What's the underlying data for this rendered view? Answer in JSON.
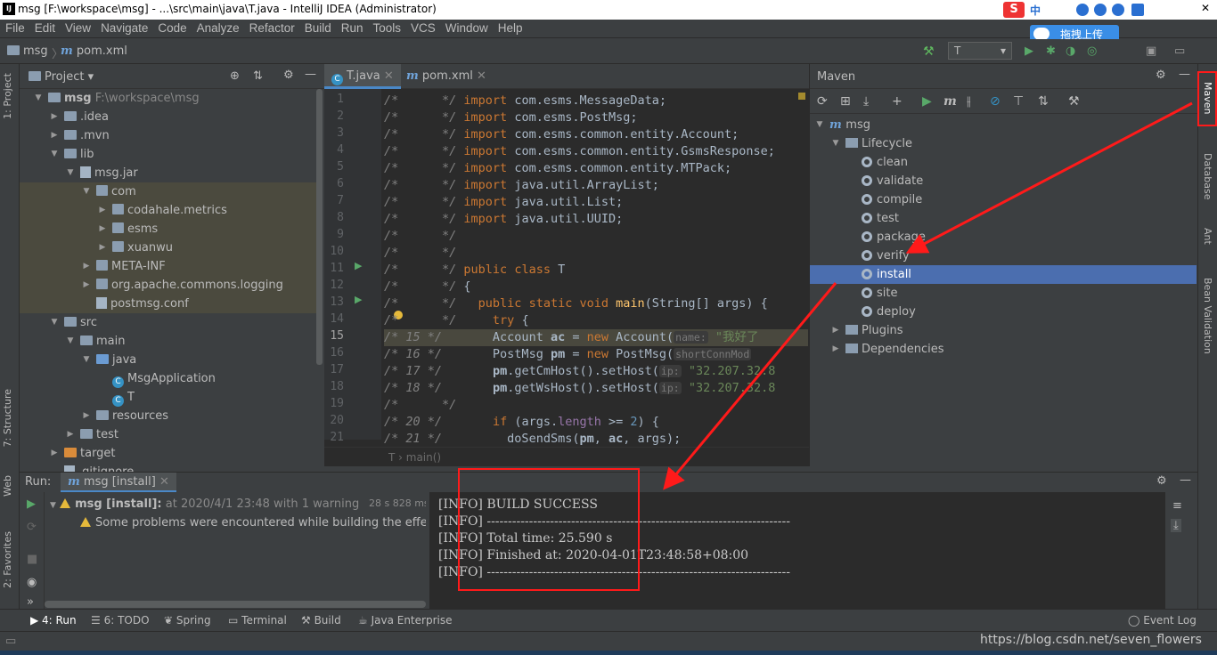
{
  "window": {
    "title": "msg [F:\\workspace\\msg] - ...\\src\\main\\java\\T.java - IntelliJ IDEA (Administrator)"
  },
  "ime": {
    "brand": "S",
    "lang": "中",
    "upload": "拖拽上传"
  },
  "menu": [
    "File",
    "Edit",
    "View",
    "Navigate",
    "Code",
    "Analyze",
    "Refactor",
    "Build",
    "Run",
    "Tools",
    "VCS",
    "Window",
    "Help"
  ],
  "nav": {
    "project": "msg",
    "file": "pom.xml",
    "run_config": "T"
  },
  "left_tabs": {
    "project": "1: Project",
    "structure": "7: Structure",
    "web": "Web",
    "favorites": "2: Favorites"
  },
  "right_tabs": {
    "maven": "Maven",
    "database": "Database",
    "ant": "Ant",
    "bean": "Bean Validation"
  },
  "project": {
    "header": "Project",
    "tree": [
      {
        "label": "msg",
        "extra": "F:\\workspace\\msg",
        "depth": 0,
        "arrow": "down",
        "icon": "folder"
      },
      {
        "label": ".idea",
        "depth": 1,
        "arrow": "right",
        "icon": "folder"
      },
      {
        "label": ".mvn",
        "depth": 1,
        "arrow": "right",
        "icon": "folder"
      },
      {
        "label": "lib",
        "depth": 1,
        "arrow": "down",
        "icon": "folder"
      },
      {
        "label": "msg.jar",
        "depth": 2,
        "arrow": "down",
        "icon": "jar"
      },
      {
        "label": "com",
        "depth": 3,
        "arrow": "down",
        "icon": "pkg",
        "hl": true
      },
      {
        "label": "codahale.metrics",
        "depth": 4,
        "arrow": "right",
        "icon": "pkg",
        "hl": true
      },
      {
        "label": "esms",
        "depth": 4,
        "arrow": "right",
        "icon": "pkg",
        "hl": true
      },
      {
        "label": "xuanwu",
        "depth": 4,
        "arrow": "right",
        "icon": "pkg",
        "hl": true
      },
      {
        "label": "META-INF",
        "depth": 3,
        "arrow": "right",
        "icon": "pkg",
        "hl": true
      },
      {
        "label": "org.apache.commons.logging",
        "depth": 3,
        "arrow": "right",
        "icon": "pkg",
        "hl": true
      },
      {
        "label": "postmsg.conf",
        "depth": 3,
        "arrow": "",
        "icon": "file",
        "hl": true
      },
      {
        "label": "src",
        "depth": 1,
        "arrow": "down",
        "icon": "folder"
      },
      {
        "label": "main",
        "depth": 2,
        "arrow": "down",
        "icon": "folder"
      },
      {
        "label": "java",
        "depth": 3,
        "arrow": "down",
        "icon": "folder-blue"
      },
      {
        "label": "MsgApplication",
        "depth": 4,
        "arrow": "",
        "icon": "class"
      },
      {
        "label": "T",
        "depth": 4,
        "arrow": "",
        "icon": "class"
      },
      {
        "label": "resources",
        "depth": 3,
        "arrow": "right",
        "icon": "folder"
      },
      {
        "label": "test",
        "depth": 2,
        "arrow": "right",
        "icon": "folder"
      },
      {
        "label": "target",
        "depth": 1,
        "arrow": "right",
        "icon": "folder-orange"
      },
      {
        "label": ".gitignore",
        "depth": 1,
        "arrow": "",
        "icon": "file"
      }
    ]
  },
  "editor": {
    "tabs": [
      "T.java",
      "pom.xml"
    ],
    "lines": [
      {
        "n": "1",
        "html": "<span class='cm'>/*      */</span> <span class='kw'>import</span> com.esms.MessageData;"
      },
      {
        "n": "2",
        "html": "<span class='cm'>/*      */</span> <span class='kw'>import</span> com.esms.PostMsg;"
      },
      {
        "n": "3",
        "html": "<span class='cm'>/*      */</span> <span class='kw'>import</span> com.esms.common.entity.Account;"
      },
      {
        "n": "4",
        "html": "<span class='cm'>/*      */</span> <span class='kw'>import</span> com.esms.common.entity.GsmsResponse;"
      },
      {
        "n": "5",
        "html": "<span class='cm'>/*      */</span> <span class='kw'>import</span> com.esms.common.entity.MTPack;"
      },
      {
        "n": "6",
        "html": "<span class='cm'>/*      */</span> <span class='kw'>import</span> java.util.ArrayList;"
      },
      {
        "n": "7",
        "html": "<span class='cm'>/*      */</span> <span class='kw'>import</span> java.util.List;"
      },
      {
        "n": "8",
        "html": "<span class='cm'>/*      */</span> <span class='kw'>import</span> java.util.UUID;"
      },
      {
        "n": "9",
        "html": "<span class='cm'>/*      */</span>"
      },
      {
        "n": "10",
        "html": "<span class='cm'>/*      */</span>"
      },
      {
        "n": "11",
        "html": "<span class='cm'>/*      */</span> <span class='kw'>public class</span> T"
      },
      {
        "n": "12",
        "html": "<span class='cm'>/*      */</span> {"
      },
      {
        "n": "13",
        "html": "<span class='cm'>/*      */</span>   <span class='kw'>public static void</span> <span class='fn'>main</span>(String[] args) {"
      },
      {
        "n": "14",
        "html": "<span class='cm'>/*      */</span>     <span class='kw'>try</span> {"
      },
      {
        "n": "15",
        "html": "<span class='cm'>/* 15 */</span>       Account <span class='bold'>ac</span> = <span class='kw'>new</span> Account(<span class='hint'>name:</span> <span class='str'>\"我好了</span>",
        "cur": true
      },
      {
        "n": "16",
        "html": "<span class='cm'>/* 16 */</span>       PostMsg <span class='bold'>pm</span> = <span class='kw'>new</span> PostMsg(<span class='hint'>shortConnMod</span>"
      },
      {
        "n": "17",
        "html": "<span class='cm'>/* 17 */</span>       <span class='bold'>pm</span>.getCmHost().setHost(<span class='hint'>ip:</span> <span class='str'>\"32.207.32.8</span>"
      },
      {
        "n": "18",
        "html": "<span class='cm'>/* 18 */</span>       <span class='bold'>pm</span>.getWsHost().setHost(<span class='hint'>ip:</span> <span class='str'>\"32.207.32.8</span>"
      },
      {
        "n": "19",
        "html": "<span class='cm'>/*      */</span>"
      },
      {
        "n": "20",
        "html": "<span class='cm'>/* 20 */</span>       <span class='kw'>if</span> (args.<span class='purple'>length</span> >= <span class='num'>2</span>) {"
      },
      {
        "n": "21",
        "html": "<span class='cm'>/* 21 */</span>         doSendSms(<span class='bold'>pm</span>, <span class='bold'>ac</span>, args);"
      }
    ],
    "breadcrumb": "T  ›  main()"
  },
  "maven": {
    "header": "Maven",
    "tree": [
      {
        "label": "msg",
        "depth": 0,
        "arrow": "down",
        "icon": "m"
      },
      {
        "label": "Lifecycle",
        "depth": 1,
        "arrow": "down",
        "icon": "folder"
      },
      {
        "label": "clean",
        "depth": 2,
        "icon": "gear"
      },
      {
        "label": "validate",
        "depth": 2,
        "icon": "gear"
      },
      {
        "label": "compile",
        "depth": 2,
        "icon": "gear"
      },
      {
        "label": "test",
        "depth": 2,
        "icon": "gear"
      },
      {
        "label": "package",
        "depth": 2,
        "icon": "gear"
      },
      {
        "label": "verify",
        "depth": 2,
        "icon": "gear"
      },
      {
        "label": "install",
        "depth": 2,
        "icon": "gear",
        "sel": true
      },
      {
        "label": "site",
        "depth": 2,
        "icon": "gear"
      },
      {
        "label": "deploy",
        "depth": 2,
        "icon": "gear"
      },
      {
        "label": "Plugins",
        "depth": 1,
        "arrow": "right",
        "icon": "folder"
      },
      {
        "label": "Dependencies",
        "depth": 1,
        "arrow": "right",
        "icon": "folder"
      }
    ]
  },
  "run": {
    "label": "Run:",
    "tab": "msg [install]",
    "entry_title": "msg [install]:",
    "entry_time": "at 2020/4/1 23:48 with 1 warning",
    "entry_duration": "28 s 828 ms",
    "warning": "Some problems were encountered while building the effective m",
    "console": [
      "[INFO] BUILD SUCCESS",
      "[INFO] ------------------------------------------------------------------------",
      "[INFO] Total time: 25.590 s",
      "[INFO] Finished at: 2020-04-01T23:48:58+08:00",
      "[INFO] ------------------------------------------------------------------------"
    ]
  },
  "bottom": {
    "run": "4: Run",
    "todo": "6: TODO",
    "spring": "Spring",
    "terminal": "Terminal",
    "build": "Build",
    "java_ent": "Java Enterprise",
    "event_log": "Event Log"
  },
  "watermark": "https://blog.csdn.net/seven_flowers",
  "colors": {
    "highlight_red": "#ff1a1a",
    "selection": "#4b6eaf"
  }
}
